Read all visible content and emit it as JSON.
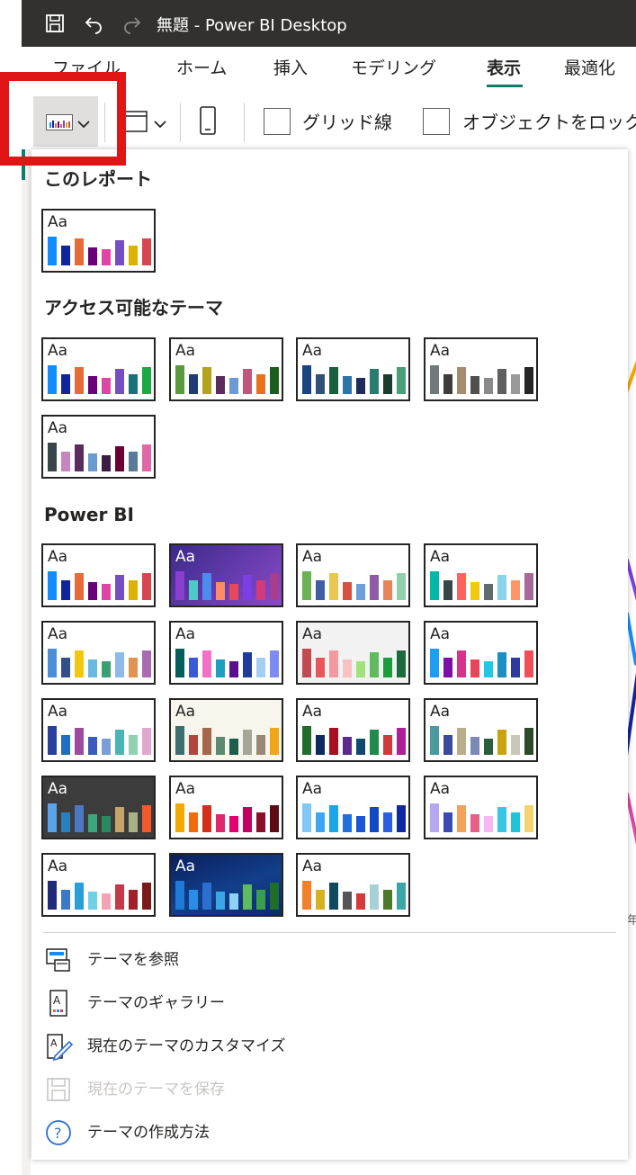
{
  "titlebar": {
    "title": "無題 - Power BI Desktop",
    "icons": [
      "save-icon",
      "undo-icon",
      "redo-icon"
    ]
  },
  "tabs": [
    {
      "label": "ファイル",
      "active": false
    },
    {
      "label": "ホーム",
      "active": false
    },
    {
      "label": "挿入",
      "active": false
    },
    {
      "label": "モデリング",
      "active": false
    },
    {
      "label": "表示",
      "active": true
    },
    {
      "label": "最適化",
      "active": false
    }
  ],
  "ribbon": {
    "theme_button_icon": "themes-icon",
    "page_view_icon": "page-view-icon",
    "mobile_icon": "mobile-layout-icon",
    "gridlines_label": "グリッド線",
    "lock_objects_label": "オブジェクトをロック"
  },
  "menu": {
    "section_this_report": "このレポート",
    "section_accessible": "アクセス可能なテーマ",
    "section_powerbi": "Power BI",
    "swatch_label": "Aa",
    "this_report_themes": [
      {
        "bg": "#ffffff",
        "aa": "#252423",
        "bars": [
          "#118dff",
          "#12239e",
          "#e66c37",
          "#6b007b",
          "#e044a7",
          "#744ec2",
          "#d9b300",
          "#d64550"
        ]
      }
    ],
    "accessible_themes": [
      {
        "bg": "#ffffff",
        "aa": "#252423",
        "bars": [
          "#118dff",
          "#12239e",
          "#e66c37",
          "#6b007b",
          "#e044a7",
          "#744ec2",
          "#197278",
          "#1aab40"
        ]
      },
      {
        "bg": "#ffffff",
        "aa": "#252423",
        "bars": [
          "#5a9a3c",
          "#1f3b73",
          "#b5a21d",
          "#5c2a5b",
          "#6b9bd1",
          "#c0567a",
          "#e6731c",
          "#1b5e20"
        ]
      },
      {
        "bg": "#ffffff",
        "aa": "#252423",
        "bars": [
          "#1a4480",
          "#31507a",
          "#195e3e",
          "#2d74a8",
          "#1b2e5a",
          "#2a7c70",
          "#1a3d2e",
          "#4a9e78"
        ]
      },
      {
        "bg": "#ffffff",
        "aa": "#252423",
        "bars": [
          "#707a7a",
          "#3c3c3c",
          "#a88b6f",
          "#505050",
          "#8a8a8a",
          "#5f5f5f",
          "#9a9a9a",
          "#262626"
        ]
      },
      {
        "bg": "#ffffff",
        "aa": "#252423",
        "bars": [
          "#374649",
          "#c785bd",
          "#5c2b5d",
          "#6b9bd1",
          "#3a1c44",
          "#6a0033",
          "#5a7a9a",
          "#e066a8"
        ]
      }
    ],
    "powerbi_themes": [
      {
        "bg": "#ffffff",
        "aa": "#252423",
        "bars": [
          "#118dff",
          "#12239e",
          "#e66c37",
          "#6b007b",
          "#e044a7",
          "#744ec2",
          "#d9b300",
          "#d64550"
        ]
      },
      {
        "bg": "linear-gradient(135deg,#3b2a8c,#8a4ac8)",
        "aa": "#ffffff",
        "bars": [
          "#8a3fd1",
          "#4ec9c9",
          "#4a8cf0",
          "#ff8a65",
          "#e8495a",
          "#7b3fe4",
          "#d33a7a",
          "#a63d8d"
        ]
      },
      {
        "bg": "#ffffff",
        "aa": "#252423",
        "bars": [
          "#6ab255",
          "#3f5ea6",
          "#eac54f",
          "#d65240",
          "#6ca0dc",
          "#8f5ba6",
          "#e8835a",
          "#8fd1ad"
        ]
      },
      {
        "bg": "#ffffff",
        "aa": "#252423",
        "bars": [
          "#01b8aa",
          "#374649",
          "#fd625e",
          "#f2c80f",
          "#5f6b6d",
          "#8ad4eb",
          "#fe9666",
          "#a66999"
        ]
      },
      {
        "bg": "#ffffff",
        "aa": "#252423",
        "bars": [
          "#4b8fd9",
          "#334f89",
          "#f2c80f",
          "#6bb8e2",
          "#3a9f72",
          "#8fb9e8",
          "#e19351",
          "#a86ab0"
        ]
      },
      {
        "bg": "#ffffff",
        "aa": "#252423",
        "bars": [
          "#045e5a",
          "#3b5bd6",
          "#f271c6",
          "#1f9fbf",
          "#5a0f8f",
          "#1f3b9e",
          "#a3d0f2",
          "#7e8bf2"
        ]
      },
      {
        "bg": "#f2f2f2",
        "aa": "#252423",
        "bars": [
          "#c44a52",
          "#e8555c",
          "#f29aa0",
          "#f7c2c4",
          "#a0e37a",
          "#5ebb5e",
          "#1a9e3c",
          "#1c6b3a"
        ]
      },
      {
        "bg": "#ffffff",
        "aa": "#252423",
        "bars": [
          "#1f9ef0",
          "#7b0fa6",
          "#d6338a",
          "#e8455a",
          "#20c7e6",
          "#1b8fc2",
          "#2c3a9e",
          "#f04f5a"
        ]
      },
      {
        "bg": "#ffffff",
        "aa": "#252423",
        "bars": [
          "#2b3f9e",
          "#1f6fbe",
          "#9e4a9e",
          "#3b5bbd",
          "#7a9fd6",
          "#4ab5b5",
          "#8fd1b2",
          "#e0a8d0"
        ]
      },
      {
        "bg": "#f7f5ec",
        "aa": "#252423",
        "bars": [
          "#3d6e6e",
          "#b3443f",
          "#a6664a",
          "#5c8a6e",
          "#1f5e4f",
          "#a6a598",
          "#9a8877",
          "#f2a516"
        ]
      },
      {
        "bg": "#ffffff",
        "aa": "#252423",
        "bars": [
          "#1f6e2a",
          "#0f2a5e",
          "#a8101f",
          "#5c2a8a",
          "#0f4a6e",
          "#1f8a4a",
          "#d23a3a",
          "#b01f9a"
        ]
      },
      {
        "bg": "#ffffff",
        "aa": "#252423",
        "bars": [
          "#4a9a9e",
          "#3c4a9e",
          "#b9ad8a",
          "#7a8ab5",
          "#2d5e3c",
          "#c9a40f",
          "#c9c7b8",
          "#2d4a2a"
        ]
      },
      {
        "bg": "#3c3c3c",
        "aa": "#ffffff",
        "bars": [
          "#5aa3e8",
          "#2c7fbe",
          "#4a78c2",
          "#3aa67a",
          "#2a8a62",
          "#c4a468",
          "#a8b087",
          "#f25a2a"
        ]
      },
      {
        "bg": "#ffffff",
        "aa": "#252423",
        "bars": [
          "#f5a800",
          "#f26c0f",
          "#d42f1a",
          "#e0266e",
          "#e6006e",
          "#c4005e",
          "#8a0f2a",
          "#5c0a14"
        ]
      },
      {
        "bg": "#ffffff",
        "aa": "#252423",
        "bars": [
          "#7ec7f7",
          "#3ea6f0",
          "#1aa6e8",
          "#1f6fe0",
          "#1856d6",
          "#0f4ac4",
          "#2a5ee6",
          "#0f2a9e"
        ]
      },
      {
        "bg": "#ffffff",
        "aa": "#252423",
        "bars": [
          "#b4a8f5",
          "#3a4ab5",
          "#f4a259",
          "#e65f8a",
          "#f5b8f5",
          "#38c6e6",
          "#1fc4d6",
          "#f5d36e"
        ]
      },
      {
        "bg": "#ffffff",
        "aa": "#252423",
        "bars": [
          "#1f2a7a",
          "#3a7ac4",
          "#2a9ed6",
          "#6fd1e6",
          "#f5a2b8",
          "#c43a4a",
          "#a11f2a",
          "#7a1a1a"
        ]
      },
      {
        "bg": "linear-gradient(160deg,#0a1f5e,#123f8a 55%,#0a2a6e)",
        "aa": "#ffffff",
        "bars": [
          "#1f7ad6",
          "#2a8ee6",
          "#2b6fd1",
          "#3aa6e8",
          "#8ed1f5",
          "#5ebb5e",
          "#3a9e4a",
          "#1f6e2a"
        ]
      },
      {
        "bg": "#ffffff",
        "aa": "#252423",
        "bars": [
          "#f27f2a",
          "#d6b21f",
          "#0f4a5e",
          "#555555",
          "#d43a3a",
          "#a6d1d6",
          "#4a7a2a",
          "#3aa6a8"
        ]
      }
    ],
    "items": [
      {
        "label": "テーマを参照",
        "icon": "browse-theme-icon",
        "disabled": false
      },
      {
        "label": "テーマのギャラリー",
        "icon": "theme-gallery-icon",
        "disabled": false
      },
      {
        "label": "現在のテーマのカスタマイズ",
        "icon": "customize-theme-icon",
        "disabled": false
      },
      {
        "label": "現在のテーマを保存",
        "icon": "save-theme-icon",
        "disabled": true
      },
      {
        "label": "テーマの作成方法",
        "icon": "help-icon",
        "disabled": false
      }
    ]
  },
  "background": {
    "side_text": "年"
  }
}
